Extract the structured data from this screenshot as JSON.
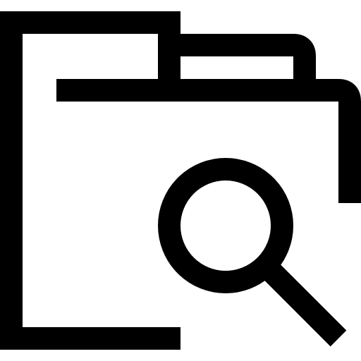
{
  "icon": {
    "name": "folder-search-icon",
    "stroke_color": "#000000",
    "background_color": "#ffffff"
  }
}
